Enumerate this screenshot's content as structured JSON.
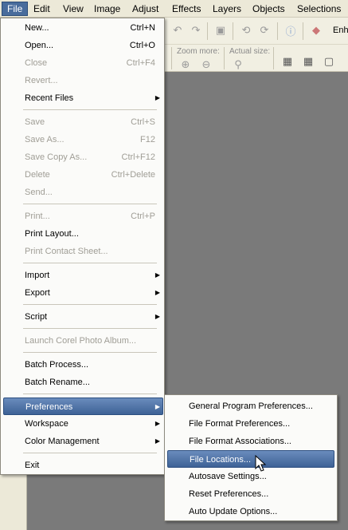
{
  "menubar": {
    "items": [
      "File",
      "Edit",
      "View",
      "Image",
      "Adjust",
      "Effects",
      "Layers",
      "Objects",
      "Selections"
    ],
    "active": "File"
  },
  "toolbar": {
    "zoom_more_label": "Zoom more:",
    "actual_size_label": "Actual size:",
    "enhance_label": "Enh"
  },
  "file_menu": {
    "items": [
      {
        "label": "New...",
        "shortcut": "Ctrl+N"
      },
      {
        "label": "Open...",
        "shortcut": "Ctrl+O"
      },
      {
        "label": "Close",
        "shortcut": "Ctrl+F4"
      },
      {
        "label": "Revert..."
      },
      {
        "label": "Recent Files"
      },
      {
        "label": "Save",
        "shortcut": "Ctrl+S"
      },
      {
        "label": "Save As...",
        "shortcut": "F12"
      },
      {
        "label": "Save Copy As...",
        "shortcut": "Ctrl+F12"
      },
      {
        "label": "Delete",
        "shortcut": "Ctrl+Delete"
      },
      {
        "label": "Send..."
      },
      {
        "label": "Print...",
        "shortcut": "Ctrl+P"
      },
      {
        "label": "Print Layout..."
      },
      {
        "label": "Print Contact Sheet..."
      },
      {
        "label": "Import"
      },
      {
        "label": "Export"
      },
      {
        "label": "Script"
      },
      {
        "label": "Launch Corel Photo Album..."
      },
      {
        "label": "Batch Process..."
      },
      {
        "label": "Batch Rename..."
      },
      {
        "label": "Preferences"
      },
      {
        "label": "Workspace"
      },
      {
        "label": "Color Management"
      },
      {
        "label": "Exit"
      }
    ]
  },
  "preferences_menu": {
    "items": [
      {
        "label": "General Program Preferences..."
      },
      {
        "label": "File Format Preferences..."
      },
      {
        "label": "File Format Associations..."
      },
      {
        "label": "File Locations..."
      },
      {
        "label": "Autosave Settings..."
      },
      {
        "label": "Reset Preferences..."
      },
      {
        "label": "Auto Update Options..."
      }
    ]
  },
  "colors": {
    "highlight": "#3e6296",
    "menu_bg": "#fbfbf9",
    "workspace_bg": "#7a7a7a"
  }
}
